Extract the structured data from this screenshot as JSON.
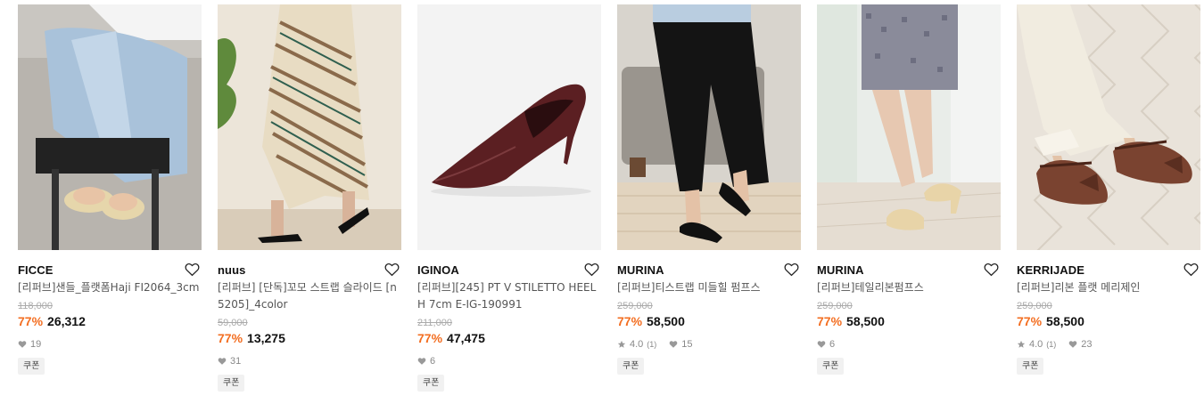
{
  "products": [
    {
      "brand": "FICCE",
      "title": "[리퍼브]샌들_플랫폼Haji FI2064_3cm",
      "original_price": "118,000",
      "discount": "77%",
      "price": "26,312",
      "rating": "",
      "reviews": "",
      "likes": "19",
      "coupon": "쿠폰",
      "image": "model-sandals-denim"
    },
    {
      "brand": "nuus",
      "title": "[리퍼브] [단독]꼬모 스트랩 슬라이드 [n5205]_4color",
      "original_price": "59,000",
      "discount": "77%",
      "price": "13,275",
      "rating": "",
      "reviews": "",
      "likes": "31",
      "coupon": "쿠폰",
      "image": "model-striped-skirt-slides"
    },
    {
      "brand": "IGINOA",
      "title": "[리퍼브][245] PT V STILETTO HEEL H 7cm E-IG-190991",
      "original_price": "211,000",
      "discount": "77%",
      "price": "47,475",
      "rating": "",
      "reviews": "",
      "likes": "6",
      "coupon": "쿠폰",
      "image": "burgundy-stiletto-pump"
    },
    {
      "brand": "MURINA",
      "title": "[리퍼브]티스트랩 미들힐 펌프스",
      "original_price": "259,000",
      "discount": "77%",
      "price": "58,500",
      "rating": "4.0",
      "reviews": "(1)",
      "likes": "15",
      "coupon": "쿠폰",
      "image": "model-black-tstrap-heels"
    },
    {
      "brand": "MURINA",
      "title": "[리퍼브]테일리본펌프스",
      "original_price": "259,000",
      "discount": "77%",
      "price": "58,500",
      "rating": "",
      "reviews": "",
      "likes": "6",
      "coupon": "쿠폰",
      "image": "model-beige-pumps-tweed"
    },
    {
      "brand": "KERRIJADE",
      "title": "[리퍼브]리본 플랫 메리제인",
      "original_price": "259,000",
      "discount": "77%",
      "price": "58,500",
      "rating": "4.0",
      "reviews": "(1)",
      "likes": "23",
      "coupon": "쿠폰",
      "image": "model-brown-maryjane-flats"
    }
  ],
  "colors": {
    "discount": "#f36e21",
    "original_price": "#aaaaaa",
    "meta": "#888888",
    "coupon_bg": "#f1f1f1"
  }
}
